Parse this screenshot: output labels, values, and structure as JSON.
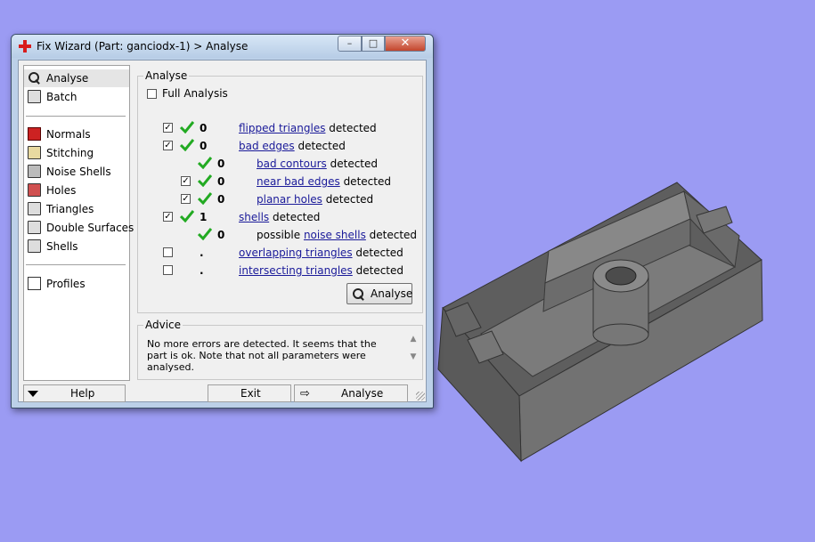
{
  "window": {
    "title": "Fix Wizard (Part: ganciodx-1) > Analyse",
    "min_glyph": "–",
    "max_glyph": "□",
    "close_glyph": "✕"
  },
  "sidebar": {
    "items": [
      {
        "label": "Analyse",
        "icon": "magnifier-icon"
      },
      {
        "label": "Batch",
        "icon": "batch-icon"
      },
      {
        "label": "Normals",
        "icon": "normals-cube-icon"
      },
      {
        "label": "Stitching",
        "icon": "stitching-cube-icon"
      },
      {
        "label": "Noise Shells",
        "icon": "noise-shells-icon"
      },
      {
        "label": "Holes",
        "icon": "holes-cube-icon"
      },
      {
        "label": "Triangles",
        "icon": "triangles-cube-icon"
      },
      {
        "label": "Double Surfaces",
        "icon": "double-surfaces-icon"
      },
      {
        "label": "Shells",
        "icon": "shells-cube-icon"
      },
      {
        "label": "Profiles",
        "icon": "profiles-icon"
      }
    ]
  },
  "analyse": {
    "group_label": "Analyse",
    "full_analysis_label": "Full Analysis",
    "rows": [
      {
        "checked": true,
        "status": "ok",
        "count": "0",
        "link": "flipped triangles",
        "suffix": " detected"
      },
      {
        "checked": true,
        "status": "ok",
        "count": "0",
        "link": "bad edges",
        "suffix": " detected"
      },
      {
        "checked": null,
        "status": "ok",
        "count": "0",
        "link": "bad contours",
        "suffix": " detected"
      },
      {
        "checked": true,
        "status": "ok",
        "count": "0",
        "link": "near bad edges",
        "suffix": " detected"
      },
      {
        "checked": true,
        "status": "ok",
        "count": "0",
        "link": "planar holes",
        "suffix": " detected"
      },
      {
        "checked": true,
        "status": "ok",
        "count": "1",
        "link": "shells",
        "suffix": " detected"
      },
      {
        "checked": null,
        "status": "ok",
        "count": "0",
        "prefix": "possible ",
        "link": "noise shells",
        "suffix": " detected"
      },
      {
        "checked": false,
        "status": "none",
        "count": ".",
        "link": "overlapping triangles",
        "suffix": " detected"
      },
      {
        "checked": false,
        "status": "none",
        "count": ".",
        "link": "intersecting triangles",
        "suffix": " detected"
      }
    ],
    "button_label": "Analyse"
  },
  "advice": {
    "group_label": "Advice",
    "text": "No more errors are detected. It seems that the part is ok. Note that not all parameters were analysed."
  },
  "bottom": {
    "help_label": "Help",
    "exit_label": "Exit",
    "analyse_label": "Analyse"
  },
  "colors": {
    "background": "#9b9bf3",
    "part_gray": "#6e6e6e",
    "check_green": "#22aa22",
    "link_blue": "#1a1a99"
  }
}
